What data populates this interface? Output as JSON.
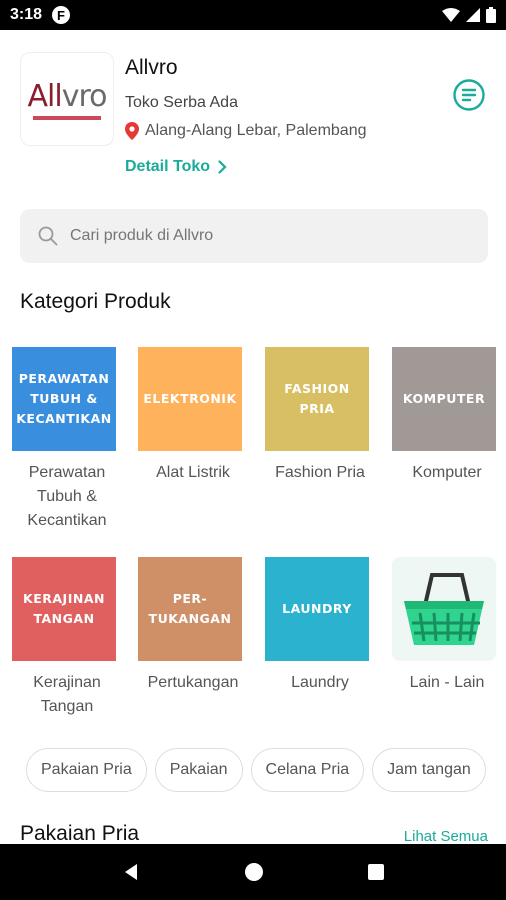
{
  "status": {
    "time": "3:18",
    "app_badge": "F"
  },
  "store": {
    "name": "Allvro",
    "logo_part1": "All",
    "logo_part2": "vro",
    "tagline": "Toko Serba Ada",
    "location": "Alang-Alang Lebar, Palembang",
    "detail_label": "Detail Toko"
  },
  "search": {
    "placeholder": "Cari produk di Allvro"
  },
  "categories_title": "Kategori Produk",
  "categories": [
    {
      "tile": "PERAWATAN TUBUH & KECANTIKAN",
      "label": "Perawatan Tubuh & Kecantikan",
      "color": "#3a8ede"
    },
    {
      "tile": "ELEKTRONIK",
      "label": "Alat Listrik",
      "color": "#ffb25c"
    },
    {
      "tile": "FASHION PRIA",
      "label": "Fashion Pria",
      "color": "#d9bf63"
    },
    {
      "tile": "KOMPUTER",
      "label": "Komputer",
      "color": "#a09995"
    },
    {
      "tile": "KERAJINAN TANGAN",
      "label": "Kerajinan Tangan",
      "color": "#e0605f"
    },
    {
      "tile": "PER-TUKANGAN",
      "label": "Pertukangan",
      "color": "#cf8f67"
    },
    {
      "tile": "LAUNDRY",
      "label": "Laundry",
      "color": "#2ab2cf"
    },
    {
      "tile": "",
      "label": "Lain - Lain",
      "color": "#eef7f4"
    }
  ],
  "chips": [
    "Pakaian Pria",
    "Pakaian",
    "Celana Pria",
    "Jam tangan"
  ],
  "section_pakaian": {
    "title": "Pakaian Pria",
    "see_all": "Lihat Semua"
  },
  "colors": {
    "accent": "#1aab9b",
    "location_pin": "#e53935"
  }
}
